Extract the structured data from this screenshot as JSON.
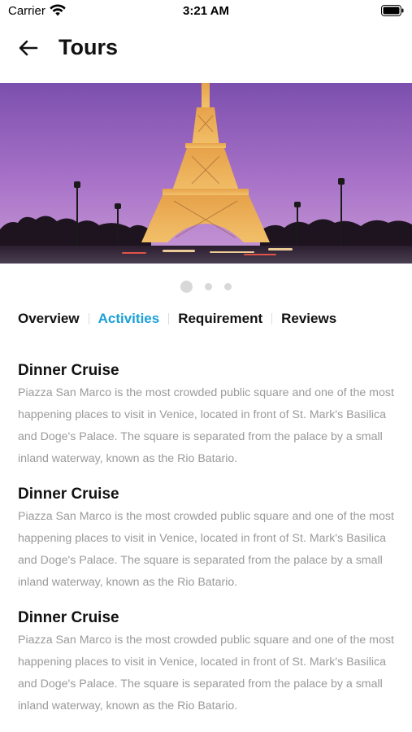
{
  "status_bar": {
    "carrier": "Carrier",
    "time": "3:21 AM"
  },
  "header": {
    "back_icon": "arrow-left-icon",
    "title": "Tours"
  },
  "hero": {
    "pager_count": 3,
    "active_page": 0
  },
  "tabs": [
    {
      "label": "Overview",
      "active": false
    },
    {
      "label": "Activities",
      "active": true
    },
    {
      "label": "Requirement",
      "active": false
    },
    {
      "label": "Reviews",
      "active": false
    }
  ],
  "sections": [
    {
      "title": "Dinner Cruise",
      "body": "Piazza San Marco is the most crowded public square and one of the most happening places to visit in Venice, located in front of St. Mark's Basilica and Doge's Palace. The square is separated from the palace by a small inland waterway, known as the Rio Batario."
    },
    {
      "title": "Dinner Cruise",
      "body": "Piazza San Marco is the most crowded public square and one of the most happening places to visit in Venice, located in front of St. Mark's Basilica and Doge's Palace. The square is separated from the palace by a small inland waterway, known as the Rio Batario."
    },
    {
      "title": "Dinner Cruise",
      "body": "Piazza San Marco is the most crowded public square and one of the most happening places to visit in Venice, located in front of St. Mark's Basilica and Doge's Palace. The square is separated from the palace by a small inland waterway, known as the Rio Batario."
    }
  ],
  "colors": {
    "accent": "#1aa0d6",
    "body_text": "#9a9a9a",
    "dot": "#d8d8d8"
  }
}
